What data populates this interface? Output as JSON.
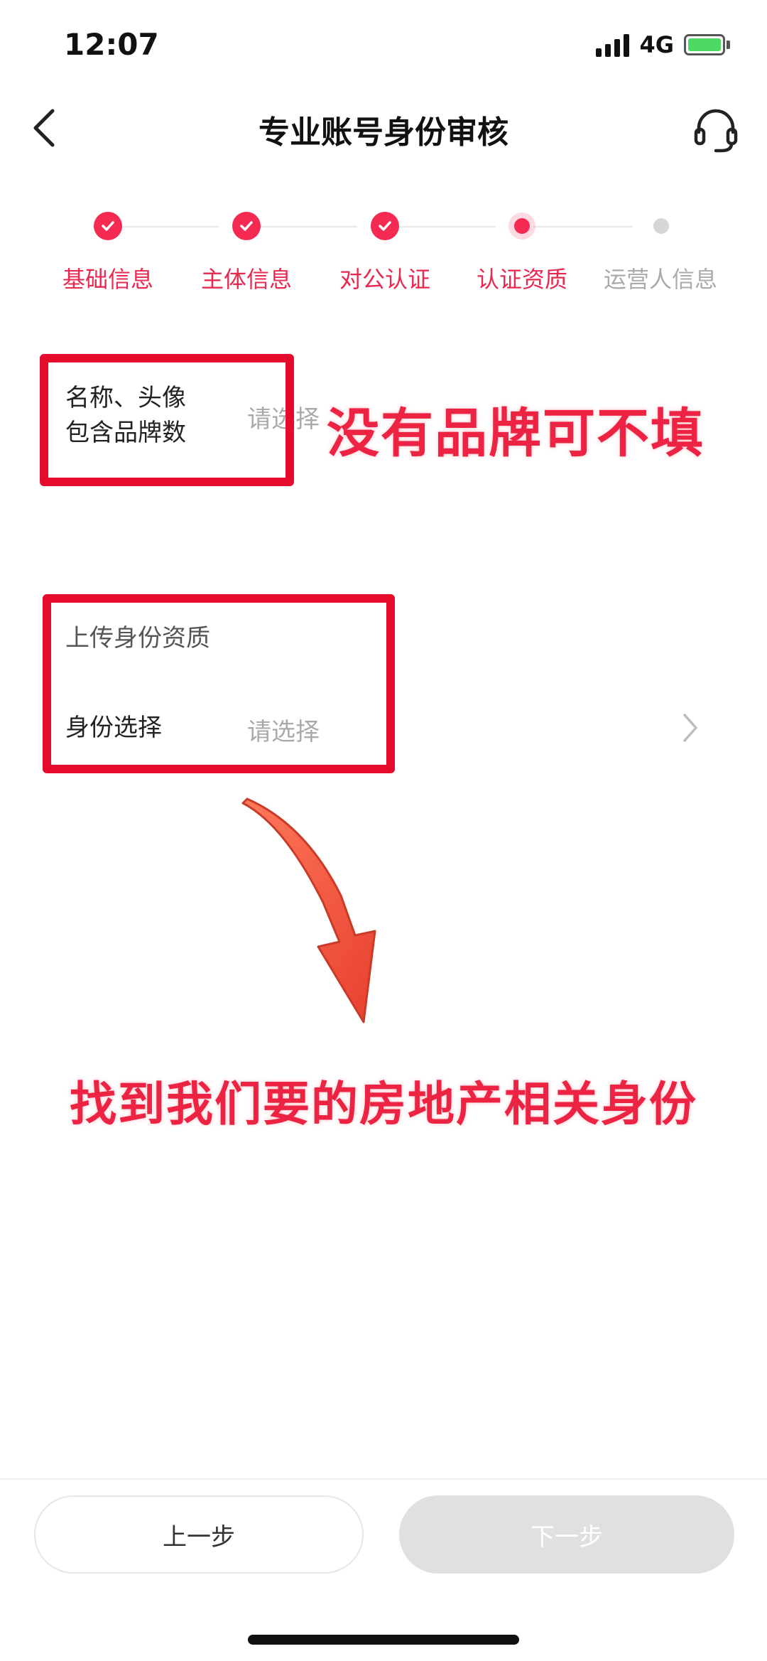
{
  "status_bar": {
    "time": "12:07",
    "network": "4G"
  },
  "nav": {
    "title": "专业账号身份审核",
    "back_icon": "chevron-left-icon",
    "support_icon": "headset-icon"
  },
  "stepper": {
    "steps": [
      {
        "label": "基础信息",
        "state": "done"
      },
      {
        "label": "主体信息",
        "state": "done"
      },
      {
        "label": "对公认证",
        "state": "done"
      },
      {
        "label": "认证资质",
        "state": "current"
      },
      {
        "label": "运营人信息",
        "state": "pending"
      }
    ]
  },
  "brand_field": {
    "label_line1": "名称、头像",
    "label_line2": "包含品牌数",
    "placeholder": "请选择"
  },
  "identity_section": {
    "title": "上传身份资质",
    "identity_label": "身份选择",
    "identity_placeholder": "请选择"
  },
  "annotations": {
    "brand_note": "没有品牌可不填",
    "identity_note": "找到我们要的房地产相关身份"
  },
  "footer": {
    "prev_label": "上一步",
    "next_label": "下一步"
  },
  "colors": {
    "accent": "#f42a52",
    "annotation_red": "#e60b2a",
    "disabled": "#e0e0e0"
  }
}
